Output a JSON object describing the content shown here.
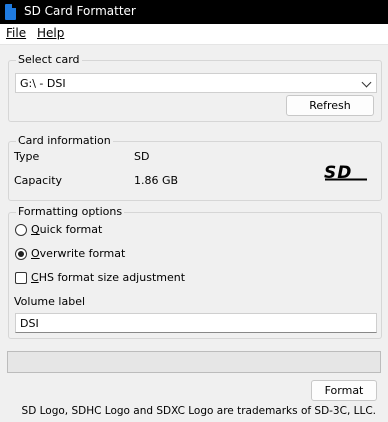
{
  "window": {
    "title": "SD Card Formatter"
  },
  "menu": {
    "file": "File",
    "help": "Help"
  },
  "select_card": {
    "legend": "Select card",
    "selected": "G:\\ - DSI",
    "refresh_label": "Refresh"
  },
  "card_info": {
    "legend": "Card information",
    "type_label": "Type",
    "type_value": "SD",
    "capacity_label": "Capacity",
    "capacity_value": "1.86 GB",
    "logo_text": "SD"
  },
  "formatting": {
    "legend": "Formatting options",
    "quick_format": "Quick format",
    "overwrite_format": "Overwrite format",
    "selected_option": "Overwrite format",
    "chs_adjustment": "CHS format size adjustment",
    "chs_checked": false,
    "volume_label_caption": "Volume label",
    "volume_label_value": "DSI"
  },
  "progress": {
    "value": 0
  },
  "actions": {
    "format_label": "Format"
  },
  "footer": {
    "trademark": "SD Logo, SDHC Logo and SDXC Logo are trademarks of SD-3C, LLC."
  },
  "colors": {
    "titlebar": "#000000",
    "app_icon": "#1f7be0",
    "window_bg": "#f0f0f0"
  }
}
